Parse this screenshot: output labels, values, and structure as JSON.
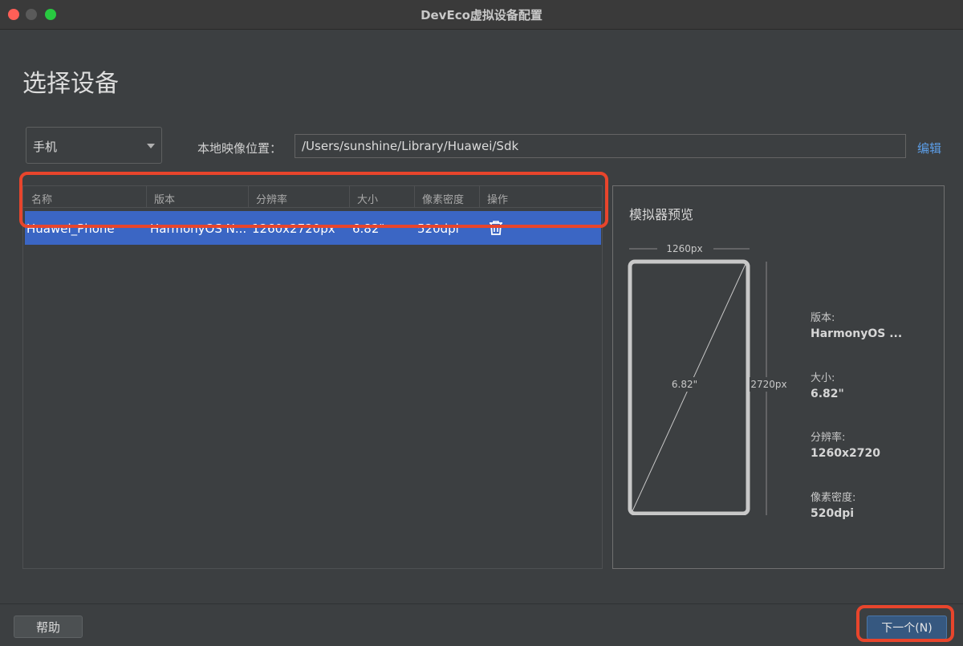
{
  "window": {
    "title": "DevEco虚拟设备配置"
  },
  "page": {
    "title": "选择设备"
  },
  "toolbar": {
    "device_type": "手机",
    "path_label": "本地映像位置：",
    "path_value": "/Users/sunshine/Library/Huawei/Sdk",
    "edit_label": "编辑"
  },
  "table": {
    "columns": [
      "名称",
      "版本",
      "分辨率",
      "大小",
      "像素密度",
      "操作"
    ],
    "rows": [
      {
        "name": "Huawei_Phone",
        "version": "HarmonyOS N...",
        "resolution": "1260x2720px",
        "size": "6.82\"",
        "density": "520dpi",
        "action_icon": "trash-icon"
      }
    ]
  },
  "preview": {
    "title": "模拟器预览",
    "width_label": "1260px",
    "height_label": "2720px",
    "diagonal_label": "6.82\"",
    "specs": [
      {
        "label": "版本:",
        "value": "HarmonyOS ..."
      },
      {
        "label": "大小:",
        "value": "6.82\""
      },
      {
        "label": "分辨率:",
        "value": "1260x2720"
      },
      {
        "label": "像素密度:",
        "value": "520dpi"
      }
    ]
  },
  "footer": {
    "help_label": "帮助",
    "next_label": "下一个(N)"
  },
  "colors": {
    "selection": "#3b66c4",
    "highlight": "#e8452c",
    "link": "#5c9ee8",
    "primary_button": "#365880"
  }
}
